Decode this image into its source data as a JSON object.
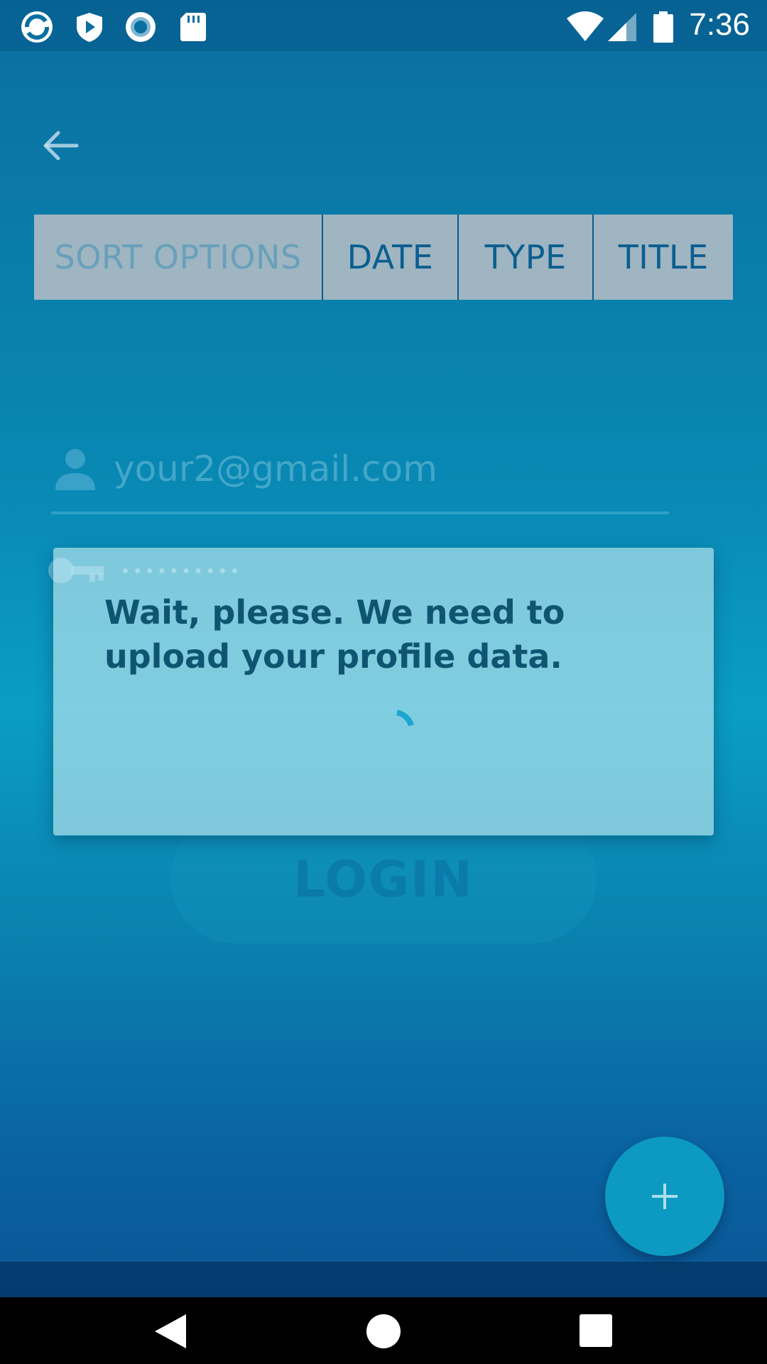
{
  "status_bar": {
    "time": "7:36",
    "icons_left": [
      "sync-app-icon",
      "shield-play-icon",
      "record-icon",
      "sd-card-icon"
    ],
    "icons_right": [
      "wifi-icon",
      "cell-signal-icon",
      "battery-icon"
    ]
  },
  "toolbar": {
    "back_icon": "arrow-left-icon"
  },
  "sort_bar": {
    "label": "SORT OPTIONS",
    "options": [
      "DATE",
      "TYPE",
      "TITLE"
    ]
  },
  "login_form": {
    "email_value": "your2@gmail.com",
    "password_mask": "••••••••••",
    "login_label": "LOGIN"
  },
  "dialog": {
    "message": "Wait, please. We need to upload your profile data."
  },
  "fab": {
    "icon": "plus-icon"
  },
  "colors": {
    "accent": "#0d9ac2",
    "sort_text": "#0a5e90",
    "dialog_text": "#0f5470"
  }
}
